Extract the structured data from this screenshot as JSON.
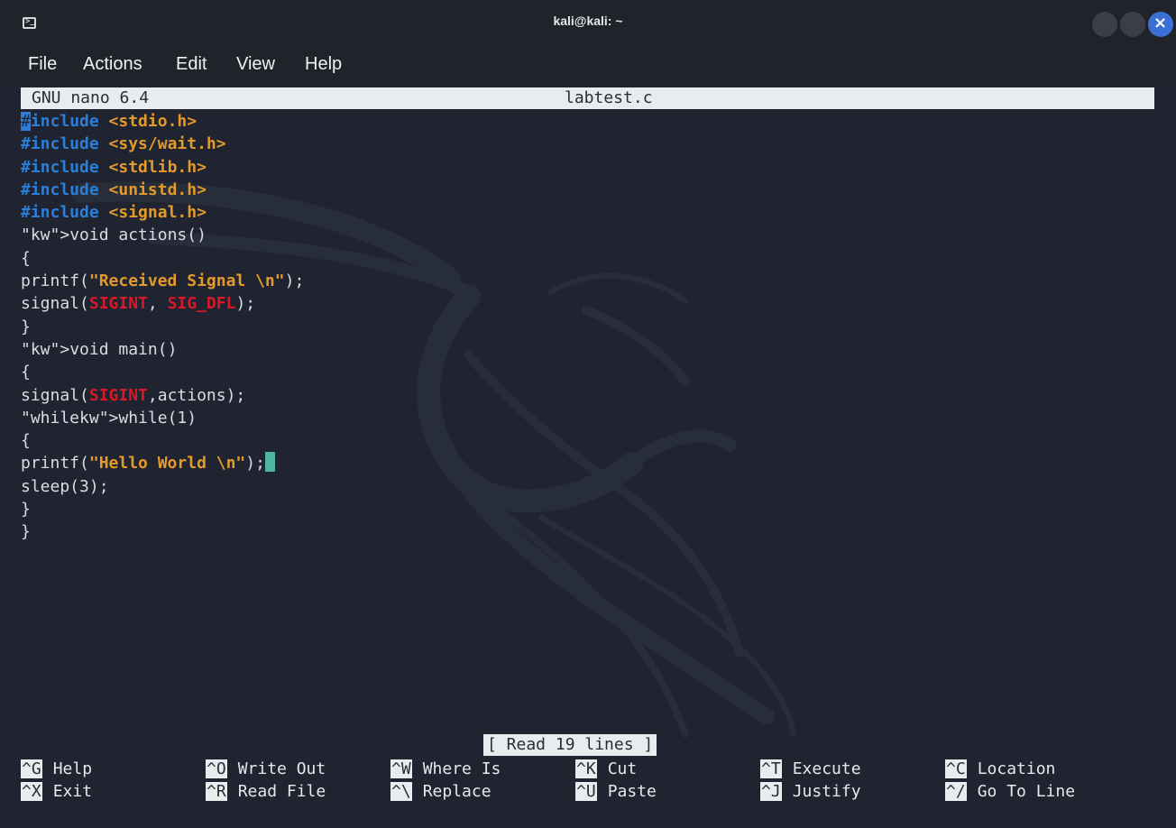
{
  "window": {
    "title": "kali@kali: ~",
    "icon": "terminal-icon",
    "term_glyph": ">_"
  },
  "menubar": {
    "items": [
      "File",
      "Actions",
      "Edit",
      "View",
      "Help"
    ]
  },
  "nano": {
    "version": "GNU nano 6.4",
    "filename": "labtest.c",
    "status": "[ Read 19 lines ]"
  },
  "code": {
    "lines": [
      "#include <stdio.h>",
      "#include <sys/wait.h>",
      "#include <stdlib.h>",
      "#include <unistd.h>",
      "#include <signal.h>",
      "void actions()",
      "{",
      "printf(\"Received Signal \\n\");",
      "signal(SIGINT, SIG_DFL);",
      "}",
      "void main()",
      "{",
      "signal(SIGINT,actions);",
      "while(1)",
      "{",
      "printf(\"Hello World \\n\");",
      "sleep(3);",
      "}",
      "}"
    ]
  },
  "shortcuts": [
    {
      "key": "^G",
      "label": "Help"
    },
    {
      "key": "^O",
      "label": "Write Out"
    },
    {
      "key": "^W",
      "label": "Where Is"
    },
    {
      "key": "^K",
      "label": "Cut"
    },
    {
      "key": "^T",
      "label": "Execute"
    },
    {
      "key": "^C",
      "label": "Location"
    },
    {
      "key": "^X",
      "label": "Exit"
    },
    {
      "key": "^R",
      "label": "Read File"
    },
    {
      "key": "^\\",
      "label": "Replace"
    },
    {
      "key": "^U",
      "label": "Paste"
    },
    {
      "key": "^J",
      "label": "Justify"
    },
    {
      "key": "^/",
      "label": "Go To Line"
    }
  ],
  "colors": {
    "background": "#1f2430",
    "preprocessor": "#2b7fd9",
    "string": "#e39a2a",
    "macro": "#d7192a",
    "cursor": "#4fb3a3",
    "close_button": "#3b6fd6"
  }
}
